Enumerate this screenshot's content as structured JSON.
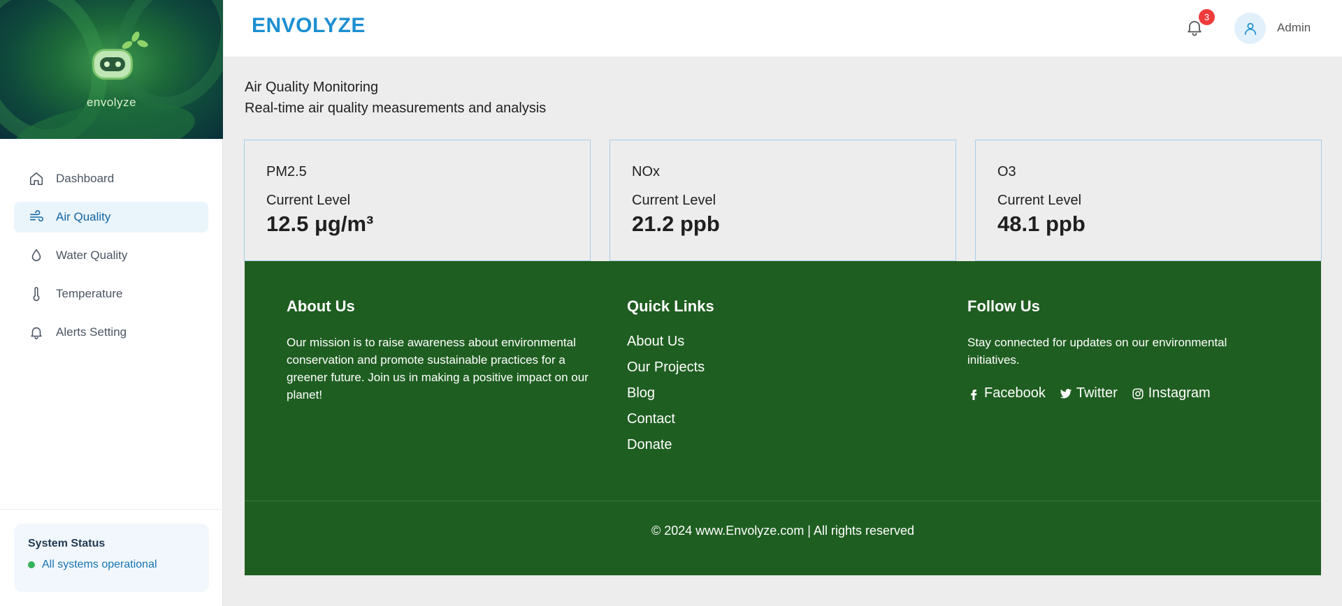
{
  "logo": {
    "text": "envolyze"
  },
  "sidebar": {
    "items": [
      {
        "label": "Dashboard",
        "icon": "home-icon"
      },
      {
        "label": "Air Quality",
        "icon": "wind-icon",
        "active": true
      },
      {
        "label": "Water Quality",
        "icon": "droplet-icon"
      },
      {
        "label": "Temperature",
        "icon": "thermometer-icon"
      },
      {
        "label": "Alerts Setting",
        "icon": "bell-icon"
      }
    ],
    "system_status": {
      "title": "System Status",
      "message": "All systems operational",
      "status_color": "#35b35a"
    }
  },
  "header": {
    "brand": "ENVOLYZE",
    "notification_count": "3",
    "user_name": "Admin"
  },
  "page": {
    "title": "Air Quality Monitoring",
    "subtitle": "Real-time air quality measurements and analysis"
  },
  "cards": [
    {
      "metric": "PM2.5",
      "label": "Current Level",
      "value": "12.5 μg/m³"
    },
    {
      "metric": "NOx",
      "label": "Current Level",
      "value": "21.2 ppb"
    },
    {
      "metric": "O3",
      "label": "Current Level",
      "value": "48.1 ppb"
    }
  ],
  "footer": {
    "about": {
      "title": "About Us",
      "text": "Our mission is to raise awareness about environmental conservation and promote sustainable practices for a greener future. Join us in making a positive impact on our planet!"
    },
    "quick_links": {
      "title": "Quick Links",
      "links": [
        "About Us",
        "Our Projects",
        "Blog",
        "Contact",
        "Donate"
      ]
    },
    "follow": {
      "title": "Follow Us",
      "text": "Stay connected for updates on our environmental initiatives.",
      "social": [
        "Facebook",
        "Twitter",
        "Instagram"
      ]
    },
    "copyright": "© 2024 www.Envolyze.com | All rights reserved"
  },
  "colors": {
    "brand": "#1c8fd1",
    "footer_bg": "#1f5e21",
    "active_nav_bg": "#eaf4fb",
    "badge": "#ef3b3b"
  }
}
